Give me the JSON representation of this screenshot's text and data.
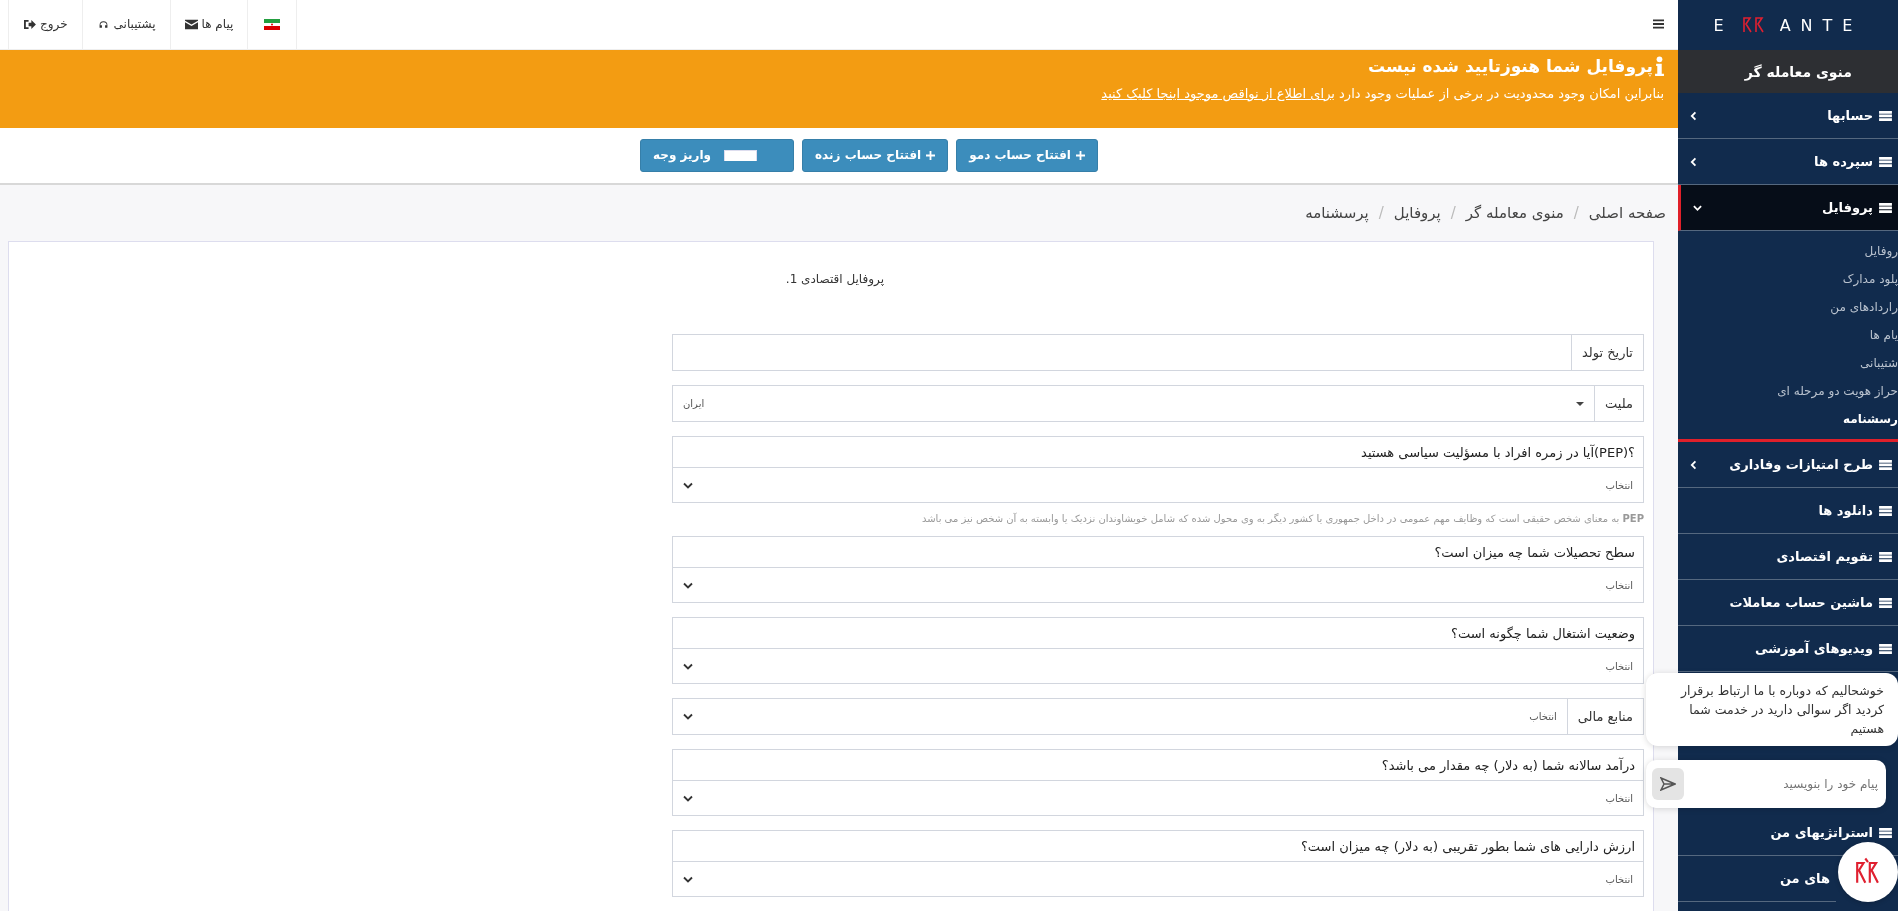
{
  "topbar": {
    "items": [
      {
        "label": "پیام ها"
      },
      {
        "label": "پشتیبانی"
      },
      {
        "label": "خروج"
      }
    ]
  },
  "banner": {
    "title": "پروفایل شما هنوزتایید شده نیست",
    "text": "بنابراین امکان وجود محدودیت در برخی از عملیات وجود دارد",
    "link": "برای اطلاع از نواقص موجود اینجا کلیک کنید"
  },
  "actions": [
    {
      "label": "افتتاح حساب دمو"
    },
    {
      "label": "افتتاح حساب زنده"
    },
    {
      "label": "واریز وجه"
    }
  ],
  "breadcrumb": {
    "separator": "/",
    "items": [
      "صفحه اصلی",
      "منوی معامله گر",
      "پروفایل",
      "پرسشنامه"
    ]
  },
  "form": {
    "title": "پروفایل اقتصادی 1.",
    "fields": [
      {
        "kind": "addon_input",
        "label": "تاریخ تولد"
      },
      {
        "kind": "addon_dropdown",
        "label": "ملیت",
        "value": "ایران"
      },
      {
        "kind": "question_select",
        "label": "؟(PEP)آیا در زمره افراد با مسؤلیت سیاسی هستید",
        "value": "انتخاب",
        "help": "**PEP** به معنای شخص حقیقی است که وظایف مهم عمومی در داخل جمهوری یا کشور دیگر به وی محول شده که شامل خویشاوندان نزدیک یا وابسته به آن شخص نیز می باشد"
      },
      {
        "kind": "question_select",
        "label": "سطح تحصیلات شما چه میزان است؟",
        "value": "انتخاب"
      },
      {
        "kind": "question_select",
        "label": "وضعیت اشتغال شما چگونه است؟",
        "value": "انتخاب"
      },
      {
        "kind": "addon_select",
        "label": "منابع مالی",
        "value": "انتخاب"
      },
      {
        "kind": "question_select",
        "label": "درآمد سالانه شما (به دلار) چه مقدار می باشد؟",
        "value": "انتخاب"
      },
      {
        "kind": "question_select",
        "label": "ارزش دارایی های شما بطور تقریبی (به دلار) چه میزان است؟",
        "value": "انتخاب"
      }
    ]
  },
  "sidebar": {
    "logo": {
      "left": "E",
      "right": "ANTE"
    },
    "header": "منوی معامله گر",
    "items": [
      {
        "kind": "group",
        "label": "حسابها",
        "expanded": false,
        "selected": false
      },
      {
        "kind": "group",
        "label": "سپرده ها",
        "expanded": false,
        "selected": false
      },
      {
        "kind": "group",
        "label": "پروفایل",
        "expanded": true,
        "selected": true,
        "children": [
          {
            "label": "روفایل",
            "selected": false
          },
          {
            "label": "پلود مدارک",
            "selected": false
          },
          {
            "label": "راردادهای من",
            "selected": false
          },
          {
            "label": "یام ها",
            "selected": false
          },
          {
            "label": "شتیبانی",
            "selected": false
          },
          {
            "label": "حراز هویت دو مرحله ای",
            "selected": false
          },
          {
            "label": "رسشنامه",
            "selected": true
          }
        ]
      },
      {
        "kind": "group",
        "label": "طرح امتیازات وفاداری",
        "expanded": false,
        "selected": false
      },
      {
        "kind": "link",
        "label": "دانلود ها",
        "selected": false
      },
      {
        "kind": "link",
        "label": "تقویم اقتصادی",
        "selected": false
      },
      {
        "kind": "link",
        "label": "ماشین حساب معاملات",
        "selected": false
      },
      {
        "kind": "link",
        "label": "ویدیوهای آموزشی",
        "selected": false
      },
      {
        "kind": "hidden"
      },
      {
        "kind": "hidden"
      },
      {
        "kind": "hidden"
      },
      {
        "kind": "link",
        "label": "استراتژیهای من",
        "selected": false
      },
      {
        "kind": "link",
        "label": "های من",
        "selected": false
      }
    ]
  },
  "chat": {
    "message": "خوشحالیم که دوباره با ما ارتباط برقرار کردید اگر سوالی دارید در خدمت شما هستیم",
    "placeholder": "پیام خود را بنویسید"
  }
}
